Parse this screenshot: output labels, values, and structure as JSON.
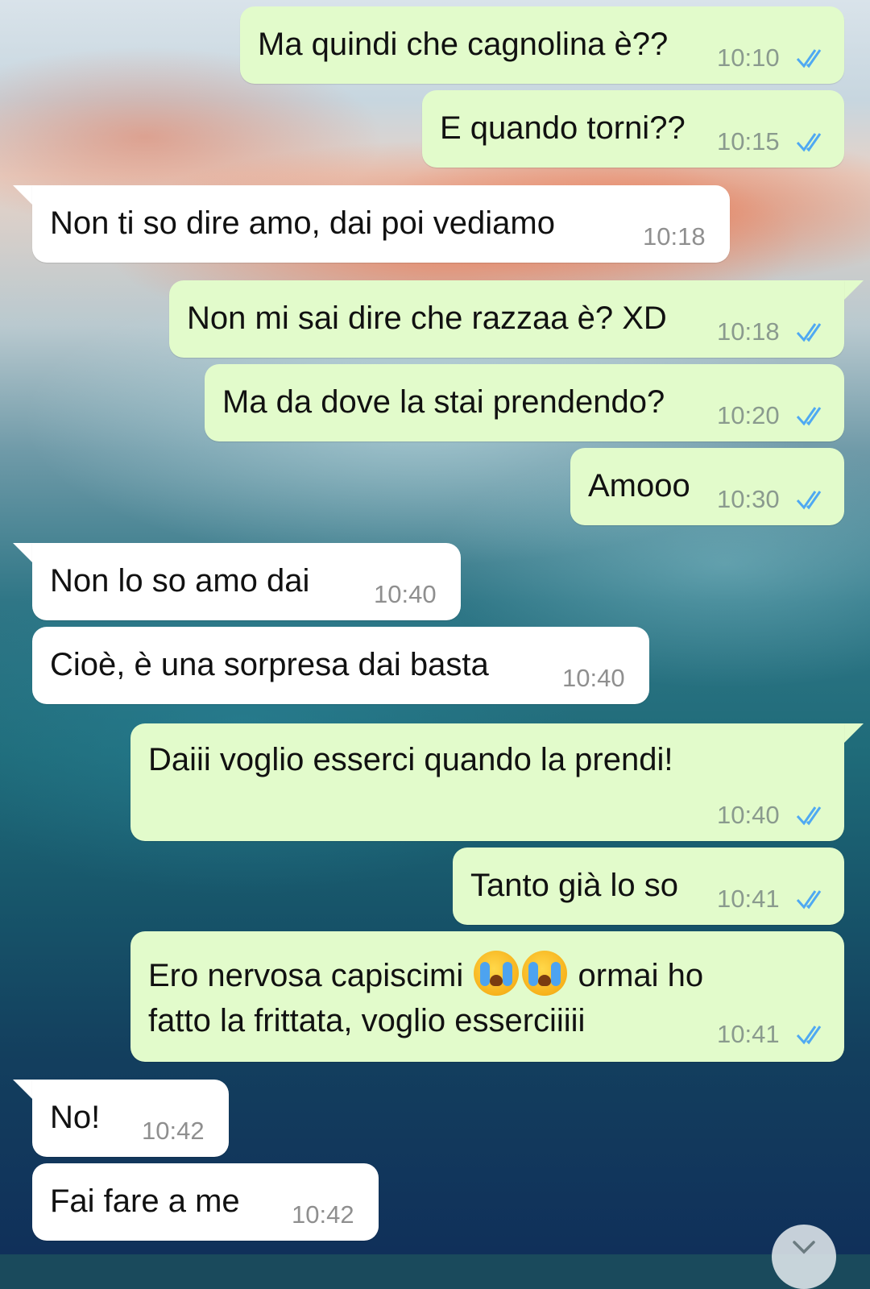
{
  "chat": {
    "background": "ocean-wave-wallpaper",
    "colors": {
      "outgoing_bubble": "#e2fbcb",
      "incoming_bubble": "#ffffff",
      "read_ticks": "#4fa9f2"
    },
    "messages": [
      {
        "direction": "outgoing",
        "text": "Ma quindi che cagnolina è??",
        "time": "10:10",
        "status": "read"
      },
      {
        "direction": "outgoing",
        "text": "E quando torni??",
        "time": "10:15",
        "status": "read"
      },
      {
        "direction": "incoming",
        "text": "Non ti so dire amo, dai poi vediamo",
        "time": "10:18"
      },
      {
        "direction": "outgoing",
        "text": "Non mi sai dire che razzaa è? XD",
        "time": "10:18",
        "status": "read"
      },
      {
        "direction": "outgoing",
        "text": "Ma da dove la stai prendendo?",
        "time": "10:20",
        "status": "read"
      },
      {
        "direction": "outgoing",
        "text": "Amooo",
        "time": "10:30",
        "status": "read"
      },
      {
        "direction": "incoming",
        "text": "Non lo so amo dai",
        "time": "10:40"
      },
      {
        "direction": "incoming",
        "text": "Cioè, è una sorpresa dai basta",
        "time": "10:40"
      },
      {
        "direction": "outgoing",
        "text": "Daiii voglio esserci quando la prendi!",
        "time": "10:40",
        "status": "read"
      },
      {
        "direction": "outgoing",
        "text": "Tanto già lo so",
        "time": "10:41",
        "status": "read"
      },
      {
        "direction": "outgoing",
        "text_parts": [
          "Ero nervosa capiscimi",
          "ormai ho",
          "fatto la frittata, voglio esserciiiii"
        ],
        "emojis": [
          "loudly-crying-face",
          "loudly-crying-face"
        ],
        "time": "10:41",
        "status": "read"
      },
      {
        "direction": "incoming",
        "text": "No!",
        "time": "10:42"
      },
      {
        "direction": "incoming",
        "text": "Fai fare a me",
        "time": "10:42"
      }
    ],
    "scroll_button_icon": "chevron-down-icon"
  }
}
